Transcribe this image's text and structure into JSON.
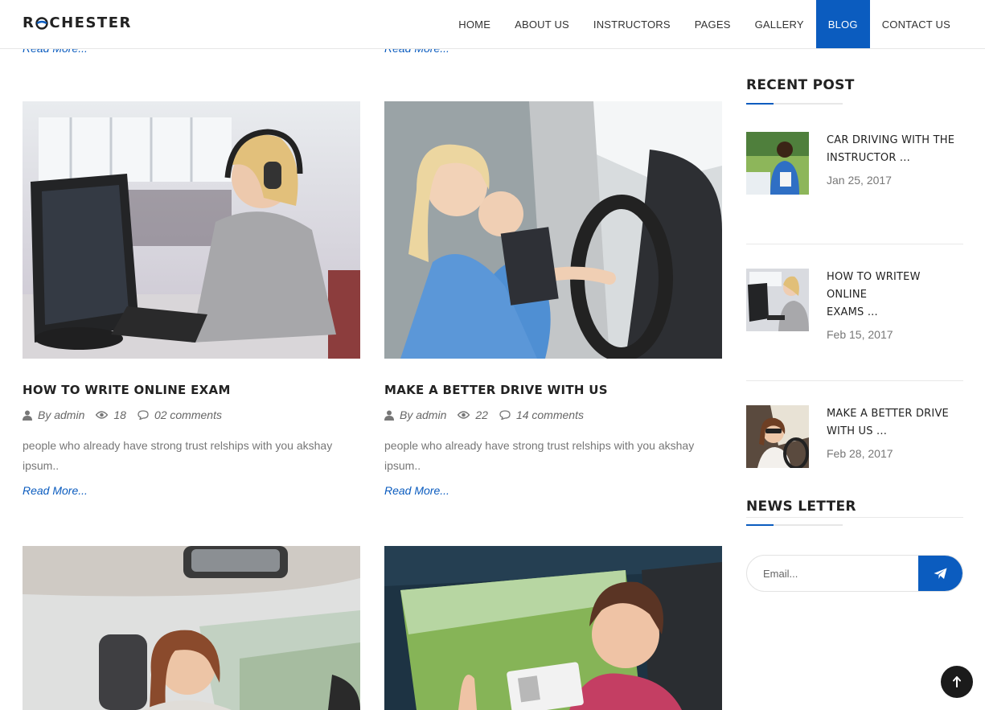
{
  "brand": {
    "logo_text_pre": "R",
    "logo_text_post": "CHESTER",
    "accent": "#0b5cbf"
  },
  "nav": {
    "items": [
      {
        "label": "HOME",
        "active": false
      },
      {
        "label": "ABOUT US",
        "active": false
      },
      {
        "label": "INSTRUCTORS",
        "active": false
      },
      {
        "label": "PAGES",
        "active": false
      },
      {
        "label": "GALLERY",
        "active": false
      },
      {
        "label": "BLOG",
        "active": true
      },
      {
        "label": "CONTACT US",
        "active": false
      }
    ]
  },
  "read_more_label": "Read More...",
  "posts": [
    {
      "title": "HOW TO WRITE ONLINE EXAM",
      "author": "By admin",
      "views": "18",
      "comments": "02 comments",
      "excerpt": "people who already have strong trust relships with you akshay ipsum..",
      "read_more": "Read More..."
    },
    {
      "title": "MAKE A BETTER DRIVE WITH US",
      "author": "By admin",
      "views": "22",
      "comments": "14 comments",
      "excerpt": "people who already have strong trust relships with you akshay ipsum..",
      "read_more": "Read More..."
    }
  ],
  "sidebar": {
    "recent_title": "RECENT POST",
    "recent": [
      {
        "title_line1": "CAR DRIVING WITH THE",
        "title_line2": "INSTRUCTOR ...",
        "date": "Jan 25, 2017"
      },
      {
        "title_line1": "HOW TO WRITEW ONLINE",
        "title_line2": "EXAMS ...",
        "date": "Feb 15, 2017"
      },
      {
        "title_line1": "MAKE A BETTER DRIVE",
        "title_line2": "WITH US ...",
        "date": "Feb 28, 2017"
      }
    ],
    "newsletter_title": "NEWS LETTER",
    "newsletter_placeholder": "Email..."
  }
}
